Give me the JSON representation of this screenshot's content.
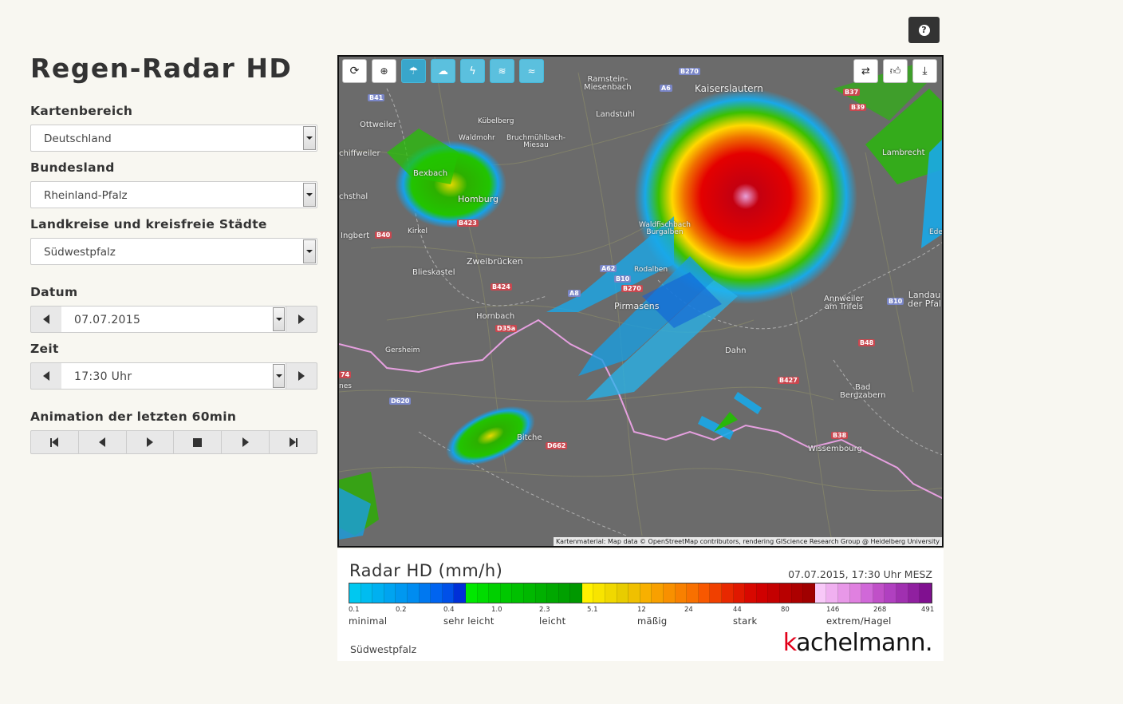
{
  "app": {
    "title": "Regen-Radar HD",
    "help_icon": "question-circle-icon"
  },
  "sidebar": {
    "kartenbereich": {
      "label": "Kartenbereich",
      "value": "Deutschland"
    },
    "bundesland": {
      "label": "Bundesland",
      "value": "Rheinland-Pfalz"
    },
    "landkreise": {
      "label": "Landkreise und kreisfreie Städte",
      "value": "Südwestpfalz"
    },
    "datum": {
      "label": "Datum",
      "value": "07.07.2015"
    },
    "zeit": {
      "label": "Zeit",
      "value": "17:30 Uhr"
    },
    "animation": {
      "label": "Animation der letzten 60min",
      "buttons": [
        "first-frame-icon",
        "step-back-icon",
        "play-icon",
        "stop-icon",
        "step-forward-icon",
        "last-frame-icon"
      ]
    }
  },
  "map": {
    "tools_left": [
      "refresh-icon",
      "zoom-in-icon",
      "umbrella-icon",
      "cloud-rain-icon",
      "lightning-icon",
      "wind-gust-icon",
      "wind-icon"
    ],
    "tools_right": [
      "retweet-icon",
      "thumbs-up-icon",
      "download-icon"
    ],
    "attribution": "Kartenmaterial: Map data © OpenStreetMap contributors, rendering GIScience Research Group @ Heidelberg University",
    "places": {
      "ramstein": "Ramstein-\nMiesenbach",
      "kaiserslautern": "Kaiserslautern",
      "ottweiler": "Ottweiler",
      "kuebelberg": "Kübelberg",
      "waldmohr": "Waldmohr",
      "bruchmuehlbach": "Bruchmühlbach-\nMiesau",
      "landstuhl": "Landstuhl",
      "lambrecht": "Lambrecht",
      "schiffweiler": "chiffweiler",
      "bexbach": "Bexbach",
      "homburg": "Homburg",
      "stshal": "chsthal",
      "kirkel": "Kirkel",
      "ingbert": "Ingbert",
      "waldfischbach": "Waldfischbach\nBurgalben",
      "edenko": "Edenko",
      "zweibruecken": "Zweibrücken",
      "rodalben": "Rodalben",
      "blieskastel": "Blieskastel",
      "pirmasens": "Pirmasens",
      "annweiler": "Annweiler\nam Trifels",
      "landau": "Landau\nder Pfal",
      "hornbach": "Hornbach",
      "gersheim": "Gersheim",
      "dahn": "Dahn",
      "nes": "nes",
      "bad_bergzabern": "Bad\nBergzabern",
      "bitche": "Bitche",
      "wissembourg": "Wissembourg"
    },
    "roads": {
      "b270_top": "B270",
      "b41": "B41",
      "a6": "A6",
      "b37": "B37",
      "b39": "B39",
      "b423": "B423",
      "b40": "B40",
      "a62": "A62",
      "b10_mid": "B10",
      "b270_mid": "B270",
      "a8": "A8",
      "b424": "B424",
      "d35a": "D35a",
      "b10_right": "B10",
      "b48": "B48",
      "b427": "B427",
      "r74": "74",
      "d620": "D620",
      "d662": "D662",
      "b38": "B38"
    }
  },
  "legend": {
    "title": "Radar HD (mm/h)",
    "timestamp": "07.07.2015, 17:30 Uhr MESZ",
    "scale_values": [
      "0.1",
      "0.2",
      "0.4",
      "1.0",
      "2.3",
      "5.1",
      "12",
      "24",
      "44",
      "80",
      "146",
      "268",
      "491"
    ],
    "categories": [
      "minimal",
      "sehr leicht",
      "leicht",
      "mäßig",
      "stark",
      "extrem/Hagel"
    ],
    "region": "Südwestpfalz",
    "brand_k": "k",
    "brand_rest": "achelmann."
  }
}
